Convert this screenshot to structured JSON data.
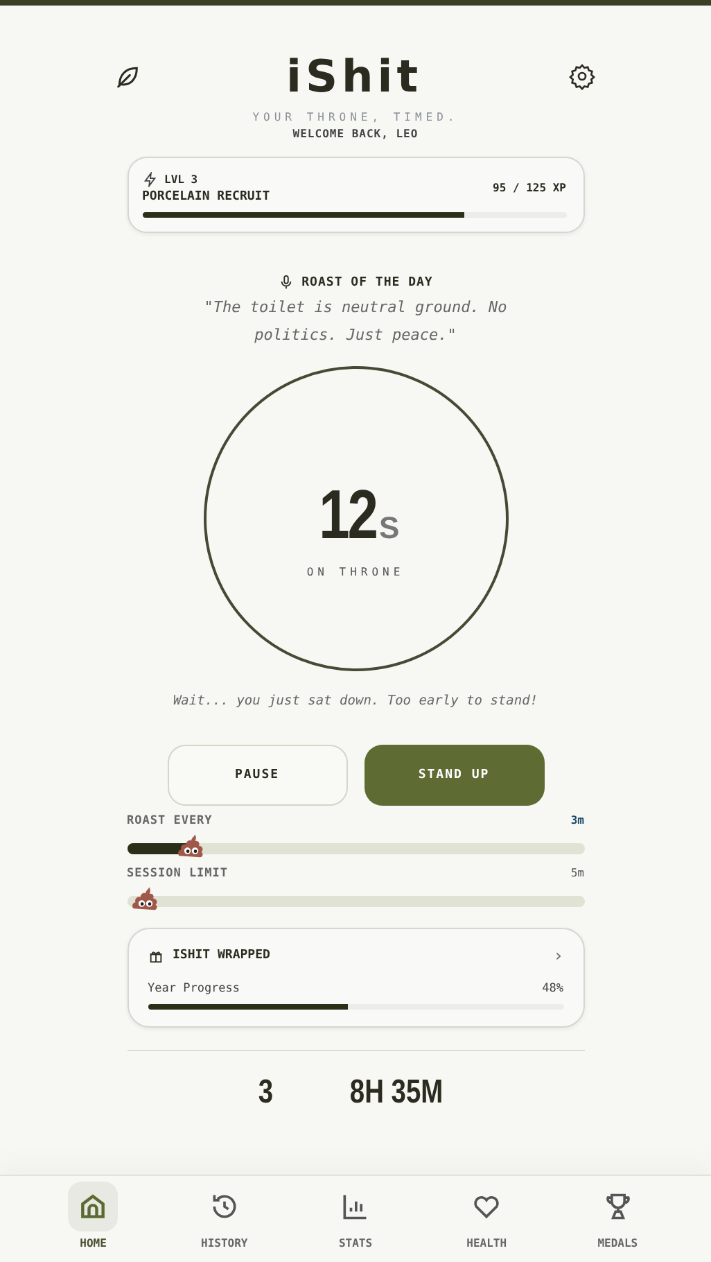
{
  "header": {
    "title": "iShit",
    "tagline": "YOUR THRONE, TIMED.",
    "welcome": "WELCOME BACK, LEO"
  },
  "level_card": {
    "level": "LVL 3",
    "rank": "PORCELAIN RECRUIT",
    "xp": "95 / 125 XP",
    "progress": {
      "level": 0.76
    }
  },
  "roast": {
    "heading": "ROAST OF THE DAY",
    "quote": "\"The toilet is neutral ground. No politics. Just peace.\""
  },
  "timer": {
    "value": "12",
    "unit": "S",
    "label": "ON THRONE"
  },
  "hint": "Wait... you just sat down. Too early to stand!",
  "buttons": [
    {
      "label": "PAUSE",
      "kind": "outline"
    },
    {
      "label": "STAND UP",
      "kind": "filled"
    }
  ],
  "sliders": [
    {
      "label": "ROAST EVERY",
      "reading": "3m",
      "level": 0.14,
      "accent": true
    },
    {
      "label": "SESSION LIMIT",
      "reading": "5m",
      "level": 0.0,
      "accent": false
    }
  ],
  "wrapped": {
    "title": "ISHIT WRAPPED",
    "chevron": "›",
    "progress_label": "Year Progress",
    "reading": "48%",
    "level": 0.48
  },
  "stats": [
    "3",
    "8H 35M"
  ],
  "nav": [
    {
      "label": "HOME",
      "selected": true
    },
    {
      "label": "HISTORY",
      "selected": false
    },
    {
      "label": "STATS",
      "selected": false
    },
    {
      "label": "HEALTH",
      "selected": false
    },
    {
      "label": "MEDALS",
      "selected": false
    }
  ]
}
